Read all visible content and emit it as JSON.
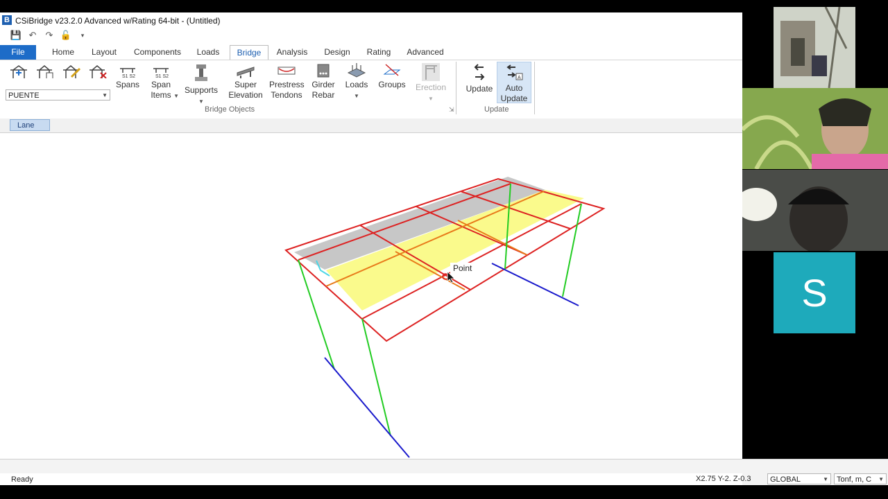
{
  "window": {
    "title": "CSiBridge v23.2.0 Advanced w/Rating 64-bit - (Untitled)",
    "logo": "B"
  },
  "quick_access": [
    "save-icon",
    "undo-icon",
    "redo-icon",
    "lock-icon",
    "customize-icon"
  ],
  "menu_tabs": [
    {
      "label": "File"
    },
    {
      "label": "Home"
    },
    {
      "label": "Layout"
    },
    {
      "label": "Components"
    },
    {
      "label": "Loads"
    },
    {
      "label": "Bridge"
    },
    {
      "label": "Analysis"
    },
    {
      "label": "Design"
    },
    {
      "label": "Rating"
    },
    {
      "label": "Advanced"
    }
  ],
  "active_tab": "Bridge",
  "ribbon": {
    "layout_line_select": "PUENTE",
    "spans": "Spans",
    "span_items_1": "Span",
    "span_items_2": "Items",
    "supports": "Supports",
    "super_elevation_1": "Super",
    "super_elevation_2": "Elevation",
    "prestress_1": "Prestress",
    "prestress_2": "Tendons",
    "girder_1": "Girder",
    "girder_2": "Rebar",
    "loads": "Loads",
    "groups": "Groups",
    "erection": "Erection",
    "group_bridge_objects": "Bridge Objects",
    "update": "Update",
    "auto_update_1": "Auto",
    "auto_update_2": "Update",
    "group_update": "Update"
  },
  "subbar": {
    "lane_tab": "Lane"
  },
  "viewport": {
    "tooltip": "Point"
  },
  "status": {
    "ready": "Ready",
    "coords": "X2.75  Y-2.  Z-0.3",
    "coord_system": "GLOBAL",
    "units": "Tonf, m, C"
  },
  "video_tiles": {
    "participant_initial": "S"
  },
  "colors": {
    "accent": "#1d6cc8",
    "frame": "#dd2222",
    "columns": "#22cc22",
    "foundation": "#1a1acc",
    "lane_fill": "#fafa80",
    "deck_fill": "#bdbdbd"
  }
}
